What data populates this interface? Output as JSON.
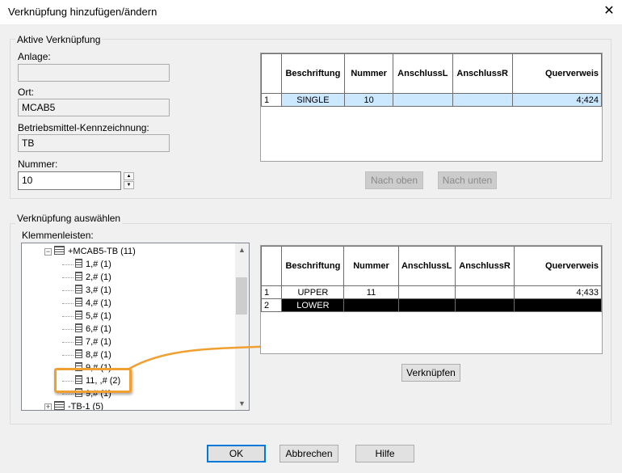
{
  "window": {
    "title": "Verknüpfung hinzufügen/ändern",
    "close_glyph": "✕"
  },
  "active": {
    "legend": "Aktive Verknüpfung",
    "anlage_label": "Anlage:",
    "anlage_value": "",
    "ort_label": "Ort:",
    "ort_value": "MCAB5",
    "bmk_label": "Betriebsmittel-Kennzeichnung:",
    "bmk_value": "TB",
    "nummer_label": "Nummer:",
    "nummer_value": "10",
    "columns": [
      "Beschriftung",
      "Nummer",
      "AnschlussL",
      "AnschlussR",
      "Querverweis"
    ],
    "rows": [
      {
        "idx": "1",
        "beschriftung": "SINGLE",
        "nummer": "10",
        "al": "",
        "ar": "",
        "querverweis": "4;424"
      }
    ],
    "btn_up": "Nach oben",
    "btn_down": "Nach unten"
  },
  "select": {
    "legend": "Verknüpfung auswählen",
    "klemmen_label": "Klemmenleisten:",
    "tree": [
      {
        "label": "+MCAB5-TB (11)",
        "level": 0,
        "toggle": "−"
      },
      {
        "label": "1,# (1)",
        "level": 1
      },
      {
        "label": "2,# (1)",
        "level": 1
      },
      {
        "label": "3,# (1)",
        "level": 1
      },
      {
        "label": "4,# (1)",
        "level": 1
      },
      {
        "label": "5,# (1)",
        "level": 1
      },
      {
        "label": "6,# (1)",
        "level": 1
      },
      {
        "label": "7,# (1)",
        "level": 1
      },
      {
        "label": "8,# (1)",
        "level": 1
      },
      {
        "label": "9,# (1)",
        "level": 1
      },
      {
        "label": "11, ,# (2)",
        "level": 1,
        "highlight": true
      },
      {
        "label": "9,# (1)",
        "level": 1
      },
      {
        "label": "-TB-1 (5)",
        "level": 0,
        "toggle": "+"
      }
    ],
    "columns": [
      "Beschriftung",
      "Nummer",
      "AnschlussL",
      "AnschlussR",
      "Querverweis"
    ],
    "rows": [
      {
        "idx": "1",
        "beschriftung": "UPPER",
        "nummer": "11",
        "al": "",
        "ar": "",
        "querverweis": "4;433"
      },
      {
        "idx": "2",
        "beschriftung": "LOWER",
        "nummer": "",
        "al": "",
        "ar": "",
        "querverweis": ""
      }
    ],
    "btn_link": "Verknüpfen"
  },
  "footer": {
    "ok": "OK",
    "cancel": "Abbrechen",
    "help": "Hilfe"
  },
  "colors": {
    "accent": "#0078d7",
    "highlight_box": "#f0a030",
    "selected_row_light": "#cce8ff",
    "selected_row_dark": "#000000"
  }
}
